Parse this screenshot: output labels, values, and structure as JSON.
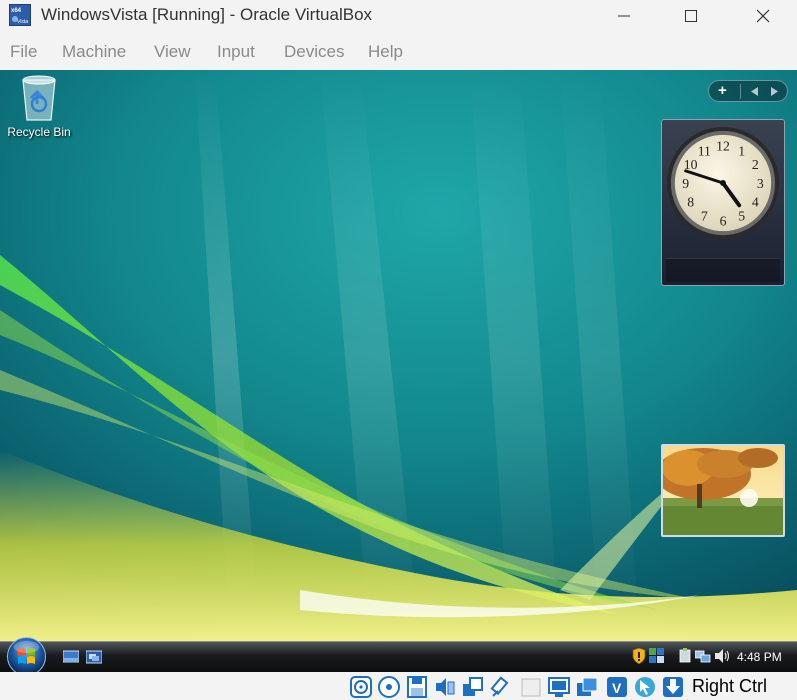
{
  "window": {
    "title": "WindowsVista [Running] - Oracle VirtualBox",
    "app_icon": "vbox-vm-icon",
    "app_icon_text_top": "x64",
    "app_icon_text_bottom": "Vista",
    "controls": [
      "minimize-icon",
      "maximize-icon",
      "close-icon"
    ]
  },
  "menubar": {
    "items": [
      "File",
      "Machine",
      "View",
      "Input",
      "Devices",
      "Help"
    ]
  },
  "guest": {
    "desktop": {
      "icons": [
        {
          "label": "Recycle Bin",
          "icon": "recycle-bin-icon"
        }
      ]
    },
    "sidebar": {
      "add_label": "+",
      "prev_icon": "left-arrow-icon",
      "next_icon": "right-arrow-icon"
    },
    "clock_gadget": {
      "numerals": [
        "12",
        "1",
        "2",
        "3",
        "4",
        "5",
        "6",
        "7",
        "8",
        "9",
        "10",
        "11"
      ],
      "hour": 4,
      "minute": 48
    },
    "slideshow_gadget": {
      "icon": "autumn-tree-photo"
    },
    "taskbar": {
      "start_icon": "windows-start-orb",
      "quick_launch": [
        "show-desktop-icon",
        "switch-windows-icon"
      ],
      "tray_icons": [
        "security-shield-icon",
        "windows-sidebar-icon",
        "safely-remove-icon",
        "network-icon",
        "volume-icon"
      ],
      "time": "4:48 PM"
    }
  },
  "statusbar": {
    "icons": [
      "hard-disk-icon",
      "optical-drive-icon",
      "floppy-icon",
      "audio-icon",
      "network-adapters-icon",
      "usb-icon",
      "shared-folders-icon",
      "display-icon",
      "recording-icon",
      "vt-x-icon",
      "mouse-integration-icon",
      "keyboard-capture-icon"
    ],
    "host_key": "Right Ctrl"
  },
  "colors": {
    "chrome_bg": "#f3f3f3",
    "menu_text": "#8a8a8a",
    "taskbar_dark": "#0c0d0f",
    "desktop_teal": "#117e86"
  }
}
